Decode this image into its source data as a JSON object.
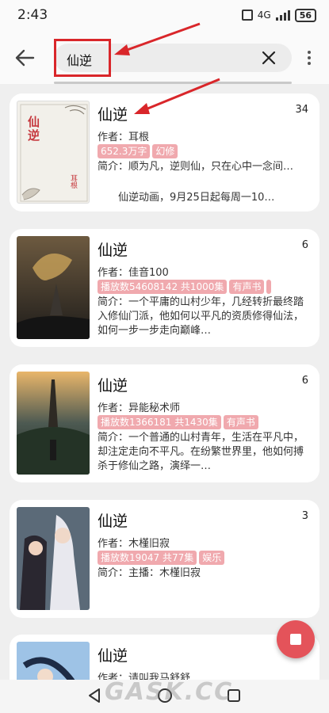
{
  "status_bar": {
    "time": "2:43",
    "network": "4G",
    "battery": "56"
  },
  "search": {
    "query": "仙逆"
  },
  "results": [
    {
      "title": "仙逆",
      "count": "34",
      "author": "作者：耳根",
      "tags": [
        "652.3万字",
        "幻修"
      ],
      "intro": "简介：顺为凡，逆则仙，只在心中一念间…",
      "extra": "仙逆动画，9月25日起每周一10…",
      "cover_text": [
        "仙逆",
        "耳根"
      ]
    },
    {
      "title": "仙逆",
      "count": "6",
      "author": "作者：佳音100",
      "tags": [
        "播放数54608142 共1000集",
        "有声书"
      ],
      "intro": "简介：一个平庸的山村少年，几经转折最终踏入修仙门派，他如何以平凡的资质修得仙法，如何一步一步走向巅峰…"
    },
    {
      "title": "仙逆",
      "count": "6",
      "author": "作者：异能秘术师",
      "tags": [
        "播放数1366181 共1430集",
        "有声书"
      ],
      "intro": "简介：一个普通的山村青年，生活在平凡中，却注定走向不平凡。在纷繁世界里，他如何搏杀于修仙之路，演绎一…"
    },
    {
      "title": "仙逆",
      "count": "3",
      "author": "作者：木槿旧寂",
      "tags": [
        "播放数19047 共77集",
        "娱乐"
      ],
      "intro": "简介：主播：木槿旧寂"
    },
    {
      "title": "仙逆",
      "author": "作者：请叫我马舒舒"
    }
  ],
  "colors": {
    "tag": "#f0a9ae",
    "fab": "#e4535a",
    "annotation": "#d9262a"
  },
  "icons": [
    "back-arrow-icon",
    "clear-icon",
    "more-vertical-icon",
    "stop-icon",
    "nav-back-icon",
    "nav-home-icon",
    "nav-recent-icon"
  ],
  "watermark": "GASK.CC"
}
